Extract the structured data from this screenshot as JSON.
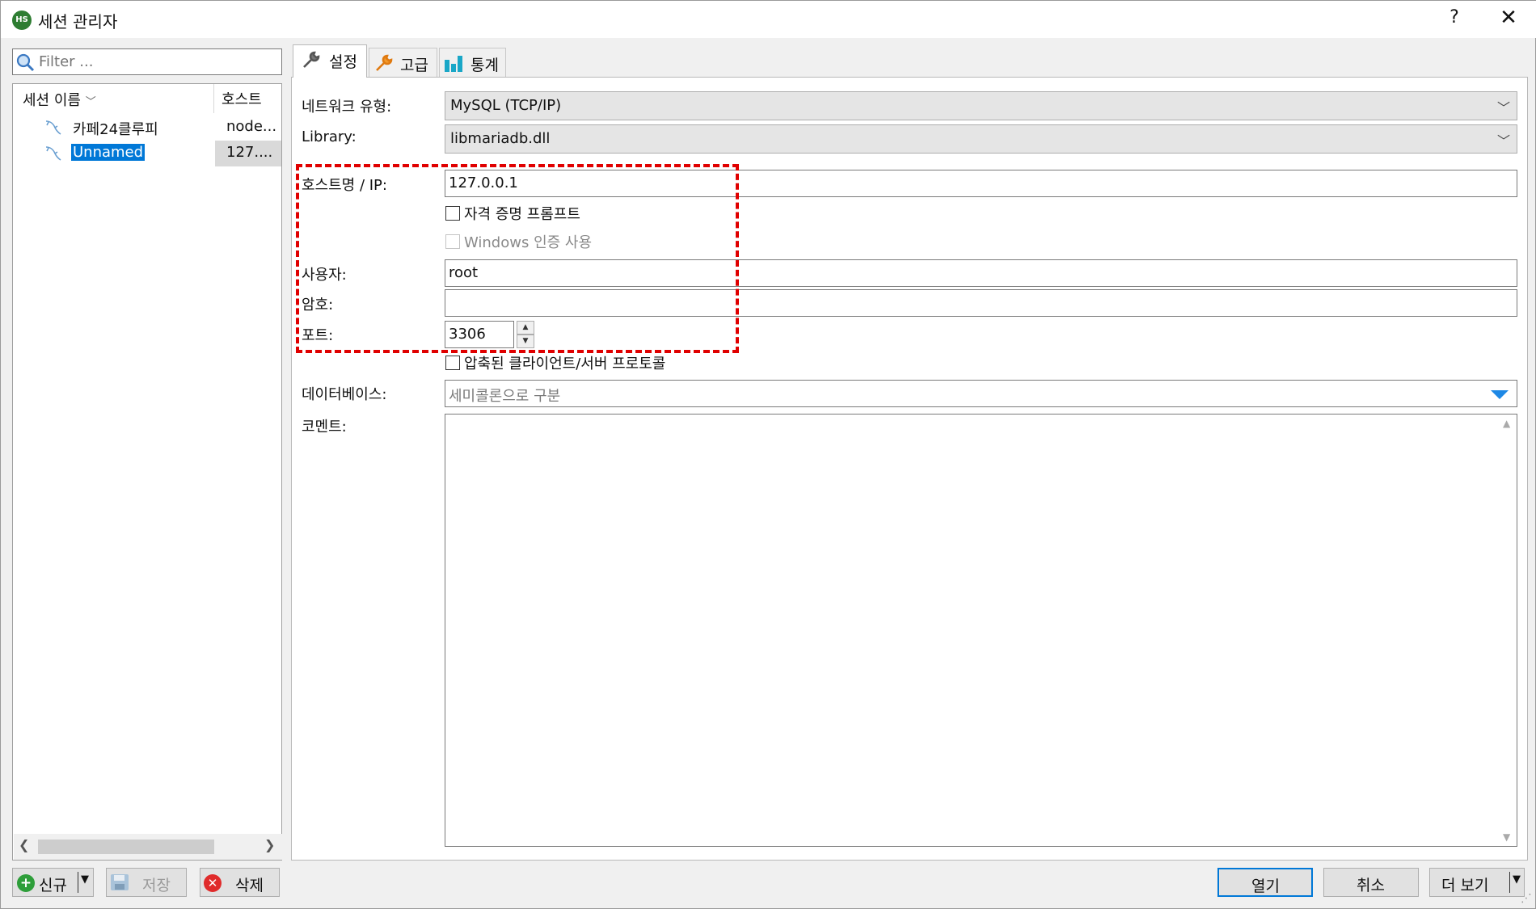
{
  "window": {
    "title": "세션 관리자",
    "help": "?",
    "close": "✕"
  },
  "left": {
    "filter_placeholder": "Filter ...",
    "col_name": "세션 이름",
    "col_host": "호스트",
    "sessions": [
      {
        "name": "카페24클루피",
        "host": "node..."
      },
      {
        "name": "Unnamed",
        "host": "127...."
      }
    ],
    "buttons": {
      "new": "신규",
      "save": "저장",
      "delete": "삭제"
    }
  },
  "tabs": [
    {
      "label": "설정"
    },
    {
      "label": "고급"
    },
    {
      "label": "통계"
    }
  ],
  "form": {
    "network_type_label": "네트워크 유형:",
    "network_type_value": "MySQL (TCP/IP)",
    "library_label": "Library:",
    "library_value": "libmariadb.dll",
    "host_label": "호스트명 / IP:",
    "host_value": "127.0.0.1",
    "prompt_credentials": "자격 증명 프롬프트",
    "windows_auth": "Windows 인증 사용",
    "user_label": "사용자:",
    "user_value": "root",
    "password_label": "암호:",
    "password_value": "",
    "port_label": "포트:",
    "port_value": "3306",
    "compressed_protocol": "압축된 클라이언트/서버 프로토콜",
    "database_label": "데이터베이스:",
    "database_placeholder": "세미콜론으로 구분",
    "comment_label": "코멘트:"
  },
  "footer": {
    "open": "열기",
    "cancel": "취소",
    "more": "더 보기"
  },
  "colors": {
    "highlight": "#e00000",
    "selection": "#0078d7",
    "primary_border": "#0078d7"
  }
}
